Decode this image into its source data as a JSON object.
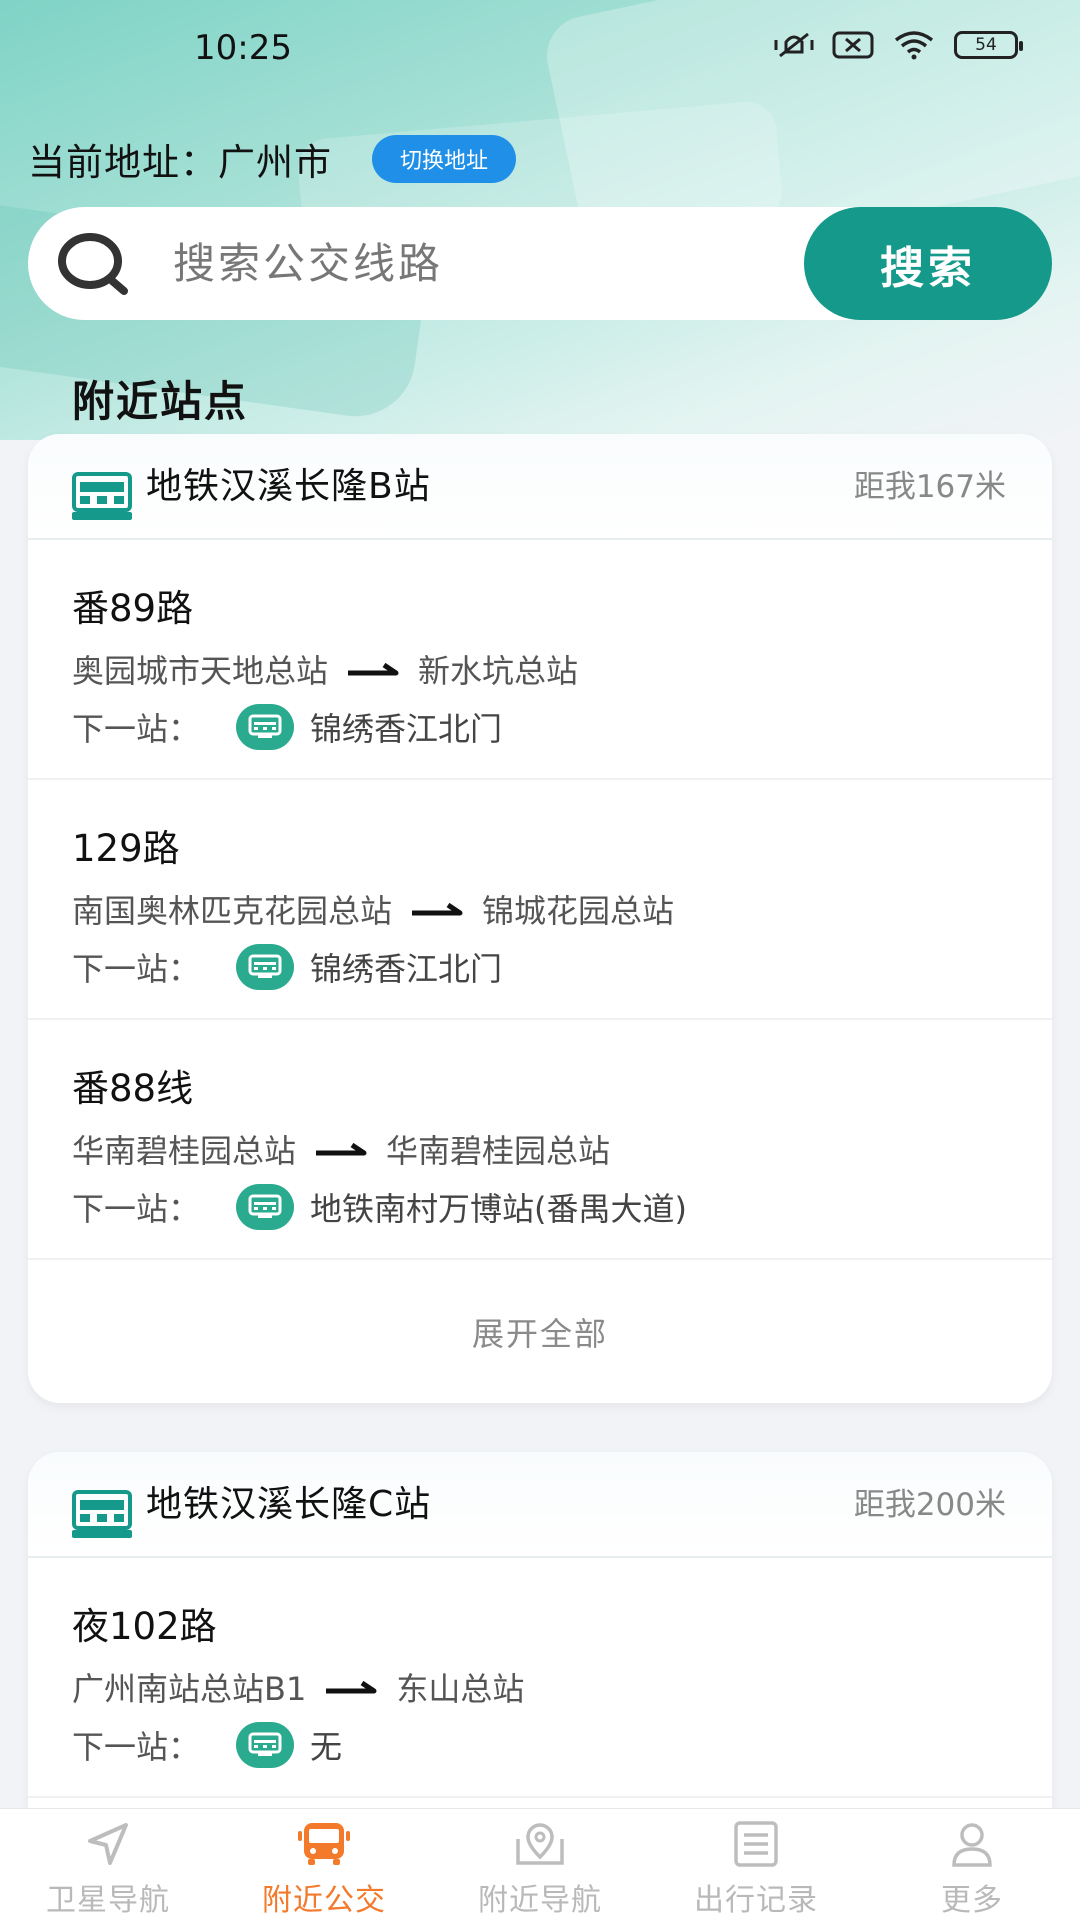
{
  "status_bar": {
    "time": "10:25",
    "battery": "54"
  },
  "location": {
    "label": "当前地址：广州市",
    "switch_label": "切换地址"
  },
  "search": {
    "placeholder": "搜索公交线路",
    "button_label": "搜索"
  },
  "section_title": "附近站点",
  "colors": {
    "accent": "#14998a",
    "active_tab": "#f27a2a",
    "switch_button": "#1f8fe8"
  },
  "stations": [
    {
      "name": "地铁汉溪长隆B站",
      "distance": "距我167米",
      "routes": [
        {
          "name": "番89路",
          "from": "奥园城市天地总站",
          "to": "新水坑总站",
          "next_label": "下一站：",
          "next_stop": "锦绣香江北门"
        },
        {
          "name": "129路",
          "from": "南国奥林匹克花园总站",
          "to": "锦城花园总站",
          "next_label": "下一站：",
          "next_stop": "锦绣香江北门"
        },
        {
          "name": "番88线",
          "from": "华南碧桂园总站",
          "to": "华南碧桂园总站",
          "next_label": "下一站：",
          "next_stop": "地铁南村万博站(番禺大道)"
        }
      ],
      "expand_label": "展开全部"
    },
    {
      "name": "地铁汉溪长隆C站",
      "distance": "距我200米",
      "routes": [
        {
          "name": "夜102路",
          "from": "广州南站总站B1",
          "to": "东山总站",
          "next_label": "下一站：",
          "next_stop": "无"
        }
      ]
    }
  ],
  "tabs": [
    {
      "label": "卫星导航",
      "icon": "navigation-arrow-icon"
    },
    {
      "label": "附近公交",
      "icon": "bus-icon",
      "active": true
    },
    {
      "label": "附近导航",
      "icon": "map-pin-icon"
    },
    {
      "label": "出行记录",
      "icon": "list-icon"
    },
    {
      "label": "更多",
      "icon": "user-icon"
    }
  ]
}
